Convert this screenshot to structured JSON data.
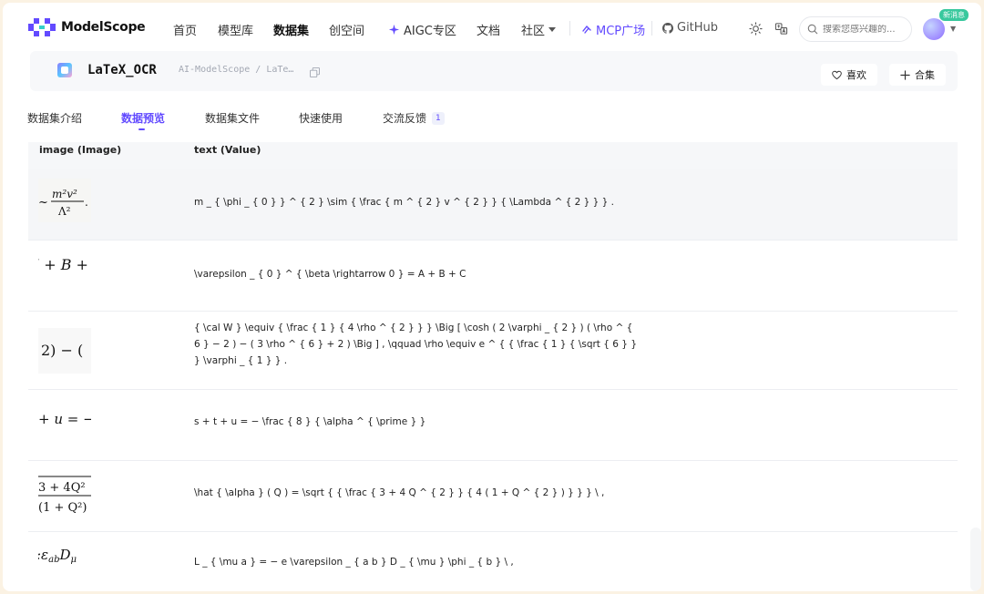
{
  "nav": {
    "brand": "ModelScope",
    "items": [
      "首页",
      "模型库",
      "数据集",
      "创空间"
    ],
    "aigc": "AIGC专区",
    "docs": "文档",
    "community": "社区",
    "mcp": "MCP广场",
    "github": "GitHub",
    "search_placeholder": "搜索您感兴趣的...",
    "new_badge": "新消息"
  },
  "dataset": {
    "title": "LaTeX_OCR",
    "breadcrumb": "AI-ModelScope / LaTe…",
    "like_label": "喜欢",
    "collect_label": "合集"
  },
  "tabs": [
    {
      "label": "数据集介绍"
    },
    {
      "label": "数据预览"
    },
    {
      "label": "数据集文件"
    },
    {
      "label": "快速使用"
    },
    {
      "label": "交流反馈",
      "count": "1"
    }
  ],
  "table": {
    "columns": [
      "image (Image)",
      "text (Value)"
    ],
    "rows": [
      {
        "image_alt": "~ m²v²/Λ².",
        "text": "m _ { \\phi _ { 0 } } ^ { 2 } \\sim { \\frac { m ^ { 2 } v ^ { 2 } } { \\Lambda ^ { 2 } } } ."
      },
      {
        "image_alt": "A + B +",
        "text": "\\varepsilon _ { 0 } ^ { \\beta \\rightarrow 0 } = A + B + C"
      },
      {
        "image_alt": "2) − (",
        "text": "{ \\cal W } \\equiv { \\frac { 1 } { 4 \\rho ^ { 2 } } } \\Big [ \\cosh ( 2 \\varphi _ { 2 } ) ( \\rho ^ { 6 } − 2 ) − ( 3 \\rho ^ { 6 } + 2 ) \\Big ] , \\qquad \\rho \\equiv e ^ { { \\frac { 1 } { \\sqrt { 6 } } } \\varphi _ { 1 } } ."
      },
      {
        "image_alt": "+ u = −",
        "text": "s + t + u = − \\frac { 8 } { \\alpha ^ { \\prime } }"
      },
      {
        "image_alt": "3 + 4Q² / (1 + Q²)",
        "text": "\\hat { \\alpha } ( Q ) = \\sqrt { { \\frac { 3 + 4 Q ^ { 2 } } { 4 ( 1 + Q ^ { 2 } ) } } } \\ ,"
      },
      {
        "image_alt": "ε_ab D_μ",
        "text": "L _ { \\mu a } = − e \\varepsilon _ { a b } D _ { \\mu } \\phi _ { b } \\ ,"
      }
    ]
  }
}
